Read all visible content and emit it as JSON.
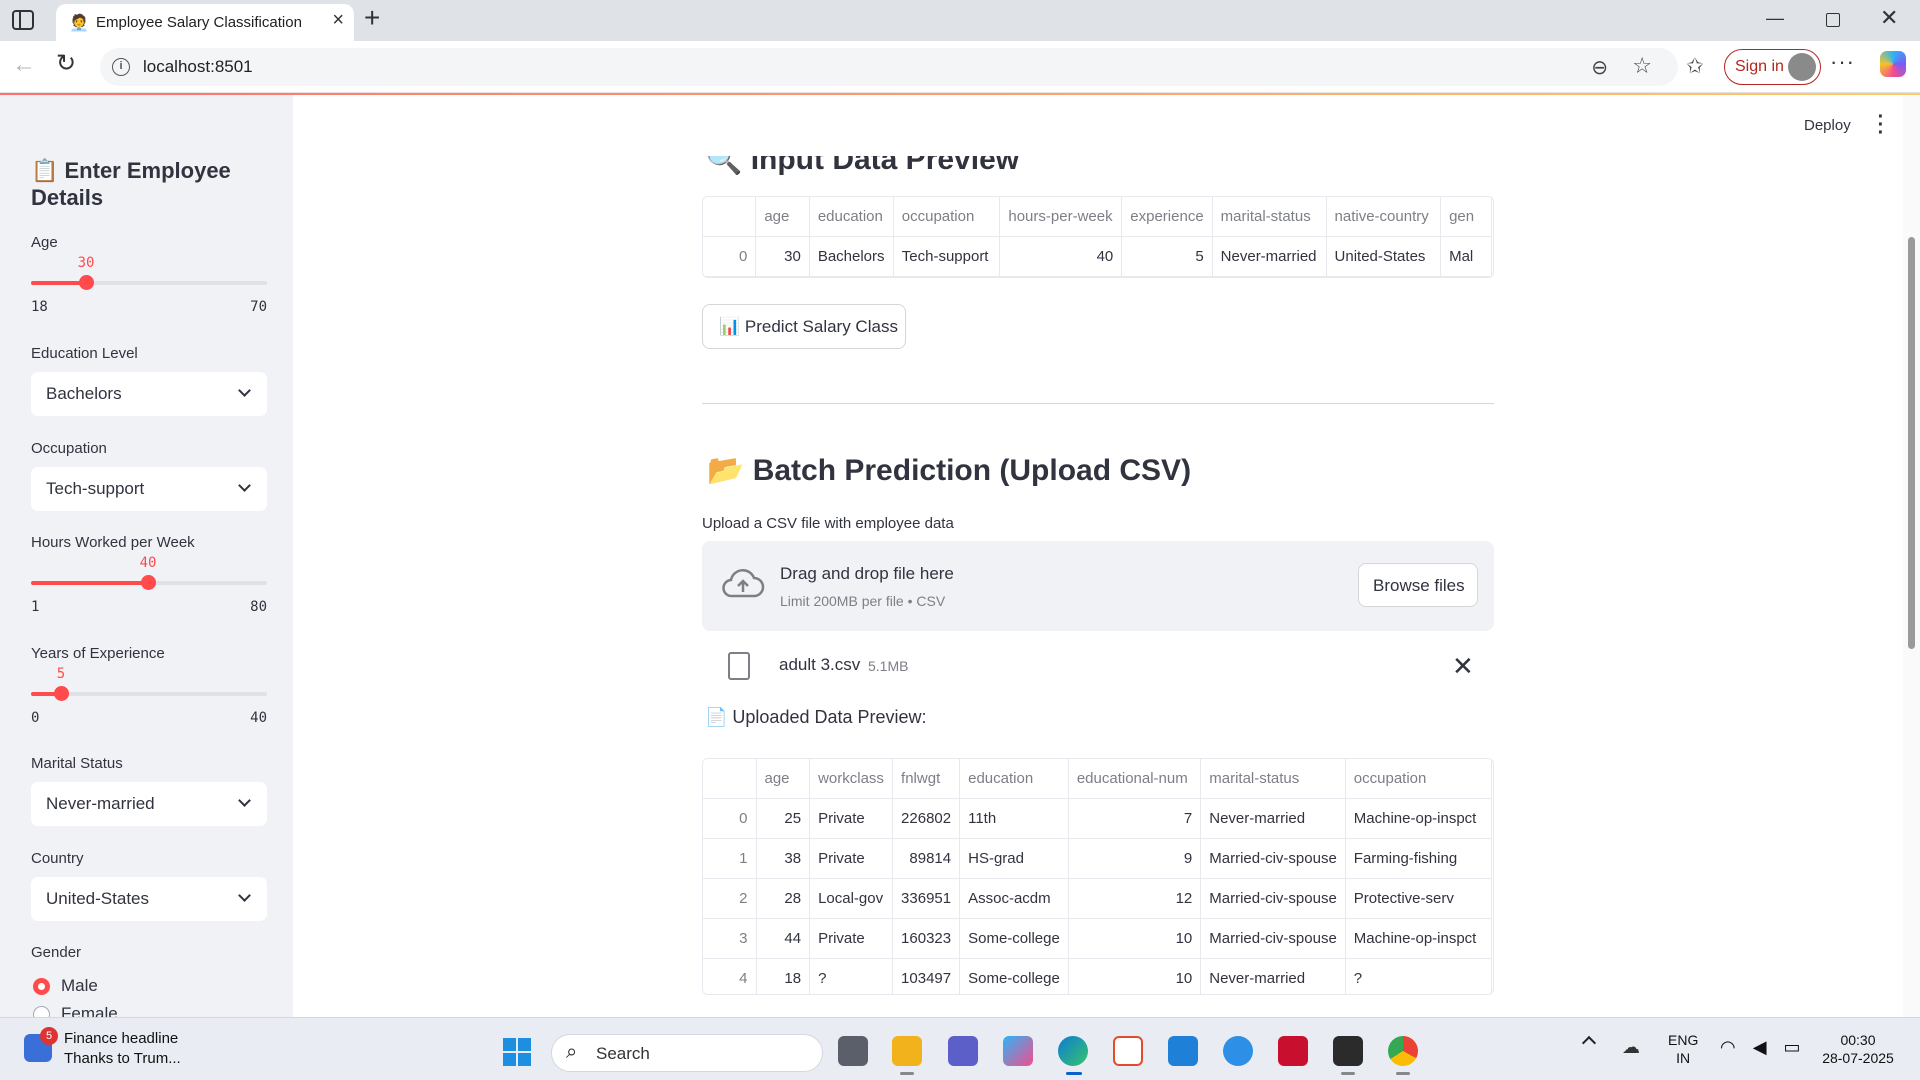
{
  "browser": {
    "tab_title": "Employee Salary Classification",
    "tab_favicon": "🧑‍💼",
    "url": "localhost:8501",
    "sign_in_label": "Sign in"
  },
  "app": {
    "deploy_label": "Deploy"
  },
  "sidebar": {
    "title": "📋 Enter Employee Details",
    "age": {
      "label": "Age",
      "value": "30",
      "min": "18",
      "max": "70",
      "fraction": 0.231
    },
    "education": {
      "label": "Education Level",
      "value": "Bachelors"
    },
    "occupation": {
      "label": "Occupation",
      "value": "Tech-support"
    },
    "hours": {
      "label": "Hours Worked per Week",
      "value": "40",
      "min": "1",
      "max": "80",
      "fraction": 0.494
    },
    "experience": {
      "label": "Years of Experience",
      "value": "5",
      "min": "0",
      "max": "40",
      "fraction": 0.125
    },
    "marital": {
      "label": "Marital Status",
      "value": "Never-married"
    },
    "country": {
      "label": "Country",
      "value": "United-States"
    },
    "gender": {
      "label": "Gender",
      "options": [
        "Male",
        "Female"
      ],
      "selected": "Male"
    }
  },
  "main": {
    "input_preview_heading": "🔍 Input Data Preview",
    "input_table": {
      "columns": [
        "",
        "age",
        "education",
        "occupation",
        "hours-per-week",
        "experience",
        "marital-status",
        "native-country",
        "gen"
      ],
      "rows": [
        [
          "0",
          "30",
          "Bachelors",
          "Tech-support",
          "40",
          "5",
          "Never-married",
          "United-States",
          "Mal"
        ]
      ]
    },
    "predict_button": "📊 Predict Salary Class",
    "batch_heading": "📂 Batch Prediction (Upload CSV)",
    "upload_caption": "Upload a CSV file with employee data",
    "uploader": {
      "title": "Drag and drop file here",
      "limit": "Limit 200MB per file • CSV",
      "browse_label": "Browse files"
    },
    "file": {
      "name": "adult 3.csv",
      "size": "5.1MB"
    },
    "uploaded_heading": "📄 Uploaded Data Preview:",
    "uploaded_table": {
      "columns": [
        "",
        "age",
        "workclass",
        "fnlwgt",
        "education",
        "educational-num",
        "marital-status",
        "occupation"
      ],
      "rows": [
        [
          "0",
          "25",
          "Private",
          "226802",
          "11th",
          "7",
          "Never-married",
          "Machine-op-inspct"
        ],
        [
          "1",
          "38",
          "Private",
          "89814",
          "HS-grad",
          "9",
          "Married-civ-spouse",
          "Farming-fishing"
        ],
        [
          "2",
          "28",
          "Local-gov",
          "336951",
          "Assoc-acdm",
          "12",
          "Married-civ-spouse",
          "Protective-serv"
        ],
        [
          "3",
          "44",
          "Private",
          "160323",
          "Some-college",
          "10",
          "Married-civ-spouse",
          "Machine-op-inspct"
        ],
        [
          "4",
          "18",
          "?",
          "103497",
          "Some-college",
          "10",
          "Never-married",
          "?"
        ]
      ]
    }
  },
  "taskbar": {
    "news_badge": "5",
    "news_title": "Finance headline",
    "news_sub": "Thanks to Trum...",
    "search_label": "Search",
    "lang_top": "ENG",
    "lang_bottom": "IN",
    "time": "00:30",
    "date": "28-07-2025"
  },
  "colors": {
    "accent": "#ff4b4b",
    "sidebar_bg": "#f0f2f6",
    "text": "#31333f"
  }
}
